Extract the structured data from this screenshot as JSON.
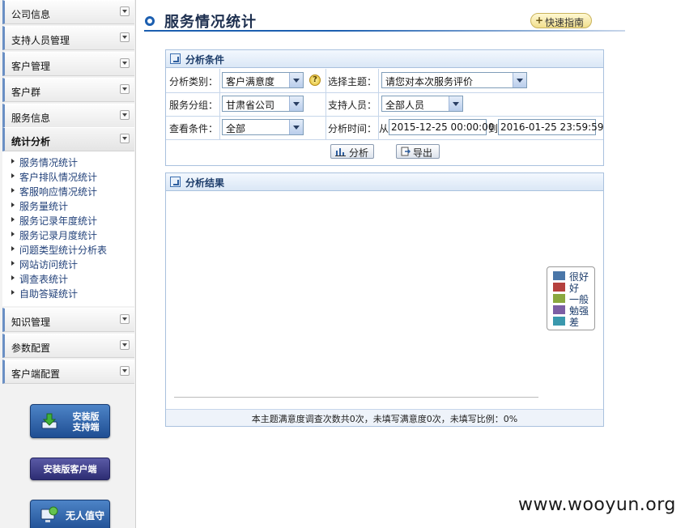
{
  "sidebar": {
    "menus_top": [
      {
        "label": "公司信息"
      },
      {
        "label": "支持人员管理"
      },
      {
        "label": "客户管理"
      },
      {
        "label": "客户群"
      },
      {
        "label": "服务信息"
      }
    ],
    "active_menu": {
      "label": "统计分析"
    },
    "sub_items": [
      {
        "label": "服务情况统计"
      },
      {
        "label": "客户排队情况统计"
      },
      {
        "label": "客服响应情况统计"
      },
      {
        "label": "服务量统计"
      },
      {
        "label": "服务记录年度统计"
      },
      {
        "label": "服务记录月度统计"
      },
      {
        "label": "问题类型统计分析表"
      },
      {
        "label": "网站访问统计"
      },
      {
        "label": "调查表统计"
      },
      {
        "label": "自助答疑统计"
      }
    ],
    "menus_bottom": [
      {
        "label": "知识管理"
      },
      {
        "label": "参数配置"
      },
      {
        "label": "客户端配置"
      }
    ],
    "buttons": {
      "support_line1": "安装版",
      "support_line2": "支持端",
      "client": "安装版客户端",
      "unattended": "无人值守"
    }
  },
  "header": {
    "title": "服务情况统计",
    "quick_guide": "快速指南",
    "quick_guide_plus": "+"
  },
  "conditions": {
    "panel_title": "分析条件",
    "category_label": "分析类别：",
    "category_value": "客户满意度",
    "help_glyph": "?",
    "topic_label": "选择主题：",
    "topic_value": "请您对本次服务评价",
    "group_label": "服务分组：",
    "group_value": "甘肃省公司",
    "staff_label": "支持人员：",
    "staff_value": "全部人员",
    "filter_label": "查看条件：",
    "filter_value": "全部",
    "time_label": "分析时间：",
    "from_label": "从",
    "from_value": "2015-12-25 00:00:00",
    "to_label": "到",
    "to_value": "2016-01-25 23:59:59",
    "analyze_button": "分析",
    "export_button": "导出"
  },
  "result": {
    "panel_title": "分析结果",
    "legend": [
      {
        "label": "很好",
        "color": "#4a76a8"
      },
      {
        "label": "好",
        "color": "#b5413e"
      },
      {
        "label": "一般",
        "color": "#8aa83f"
      },
      {
        "label": "勉强",
        "color": "#7c5ea4"
      },
      {
        "label": "差",
        "color": "#3a98ad"
      }
    ],
    "summary": "本主题满意度调查次数共0次，未填写满意度0次，未填写比例：0%"
  },
  "watermark": "www.wooyun.org"
}
